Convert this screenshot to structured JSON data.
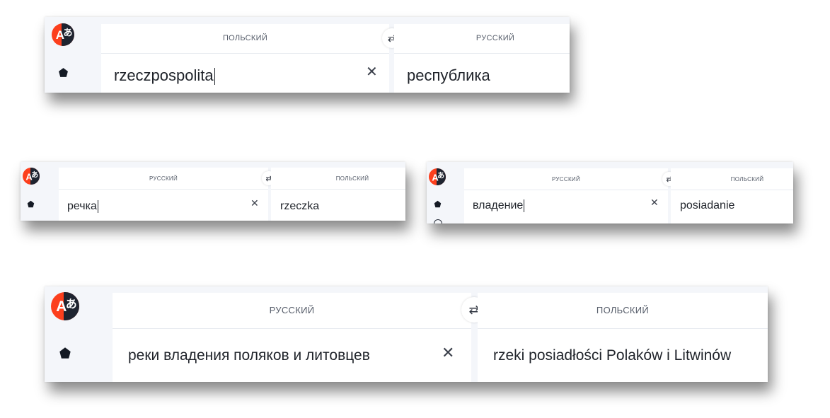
{
  "panels": [
    {
      "source_lang": "ПОЛЬСКИЙ",
      "target_lang": "РУССКИЙ",
      "input_text": "rzeczpospolita",
      "output_text": "республика"
    },
    {
      "source_lang": "РУССКИЙ",
      "target_lang": "ПОЛЬСКИЙ",
      "input_text": "речка",
      "output_text": "rzeczka"
    },
    {
      "source_lang": "РУССКИЙ",
      "target_lang": "ПОЛЬСКИЙ",
      "input_text": "владение",
      "output_text": "posiadanie"
    },
    {
      "source_lang": "РУССКИЙ",
      "target_lang": "ПОЛЬСКИЙ",
      "input_text": "реки владения поляков и литовцев",
      "output_text": "rzeki posiadłości Polaków i Litwinów"
    }
  ],
  "icons": {
    "logo": "translator-logo-icon",
    "home": "home-icon",
    "swap": "swap-arrows-icon",
    "clear": "close-icon"
  },
  "colors": {
    "logo_red": "#fc3f1d",
    "logo_dark": "#1e2430",
    "sidebar": "#f4f6fa"
  }
}
